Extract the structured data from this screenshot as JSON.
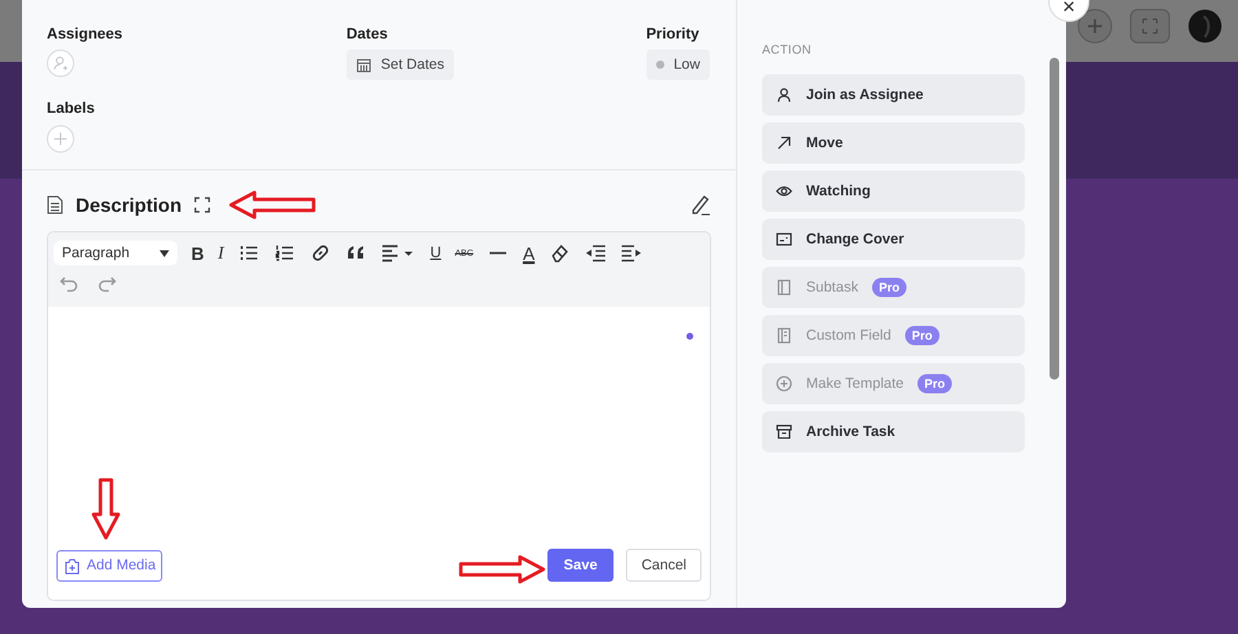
{
  "close": "×",
  "fields": [
    {
      "label": "Assignees",
      "kind": "avatar"
    },
    {
      "label": "Dates",
      "kind": "dates",
      "value": "Set Dates"
    },
    {
      "label": "Priority",
      "kind": "priority",
      "value": "Low"
    }
  ],
  "labels": {
    "label": "Labels"
  },
  "description": {
    "title": "Description",
    "format": "Paragraph",
    "toolbar": [
      {
        "kind": "bold",
        "text": "B"
      },
      {
        "kind": "italic",
        "text": "I"
      },
      {
        "kind": "bullets"
      },
      {
        "kind": "numbers"
      },
      {
        "kind": "link"
      },
      {
        "kind": "quote"
      },
      {
        "kind": "align"
      },
      {
        "kind": "underline",
        "text": "U"
      },
      {
        "kind": "strike",
        "text": "ABC"
      },
      {
        "kind": "rule"
      },
      {
        "kind": "color",
        "text": "A"
      },
      {
        "kind": "eraser"
      },
      {
        "kind": "outdent"
      },
      {
        "kind": "indent"
      },
      {
        "kind": "undo"
      },
      {
        "kind": "redo"
      }
    ]
  },
  "editor": {
    "add_media": "Add Media",
    "save": "Save",
    "cancel": "Cancel"
  },
  "actions": {
    "heading": "ACTION",
    "items": [
      {
        "label": "Join as Assignee",
        "kind": "user",
        "disabled": false
      },
      {
        "label": "Move",
        "kind": "move",
        "disabled": false
      },
      {
        "label": "Watching",
        "kind": "eye",
        "disabled": false
      },
      {
        "label": "Change Cover",
        "kind": "cover",
        "disabled": false
      },
      {
        "label": "Subtask",
        "kind": "subtask",
        "disabled": true,
        "badge": "Pro"
      },
      {
        "label": "Custom Field",
        "kind": "field",
        "disabled": true,
        "badge": "Pro"
      },
      {
        "label": "Make Template",
        "kind": "template",
        "disabled": true,
        "badge": "Pro"
      },
      {
        "label": "Archive Task",
        "kind": "archive",
        "disabled": false
      }
    ]
  }
}
